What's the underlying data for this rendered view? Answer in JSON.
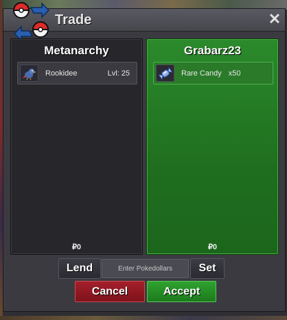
{
  "window": {
    "title": "Trade",
    "close_symbol": "✕"
  },
  "icons": {
    "logo": "pokeball-trade-logo-icon",
    "close": "close-icon",
    "rookidee": "rookidee-pokemon-icon",
    "rare_candy": "rare-candy-icon"
  },
  "colors": {
    "left_panel_bg": "#26262b",
    "right_panel_bg": "#1f6e1f",
    "cancel_bg": "#a41f2a",
    "accept_bg": "#2fa22f",
    "logo_red": "#e02a2a",
    "logo_blue": "#2a5fb0"
  },
  "trade": {
    "left": {
      "player_name": "Metanarchy",
      "items": [
        {
          "name": "Rookidee",
          "detail": "Lvl: 25"
        }
      ],
      "money": "₽0"
    },
    "right": {
      "player_name": "Grabarz23",
      "items": [
        {
          "name": "Rare Candy",
          "detail": "x50"
        }
      ],
      "money": "₽0"
    }
  },
  "controls": {
    "lend_label": "Lend",
    "pokedollars_placeholder": "Enter Pokedollars",
    "pokedollars_value": "",
    "set_label": "Set",
    "cancel_label": "Cancel",
    "accept_label": "Accept"
  }
}
